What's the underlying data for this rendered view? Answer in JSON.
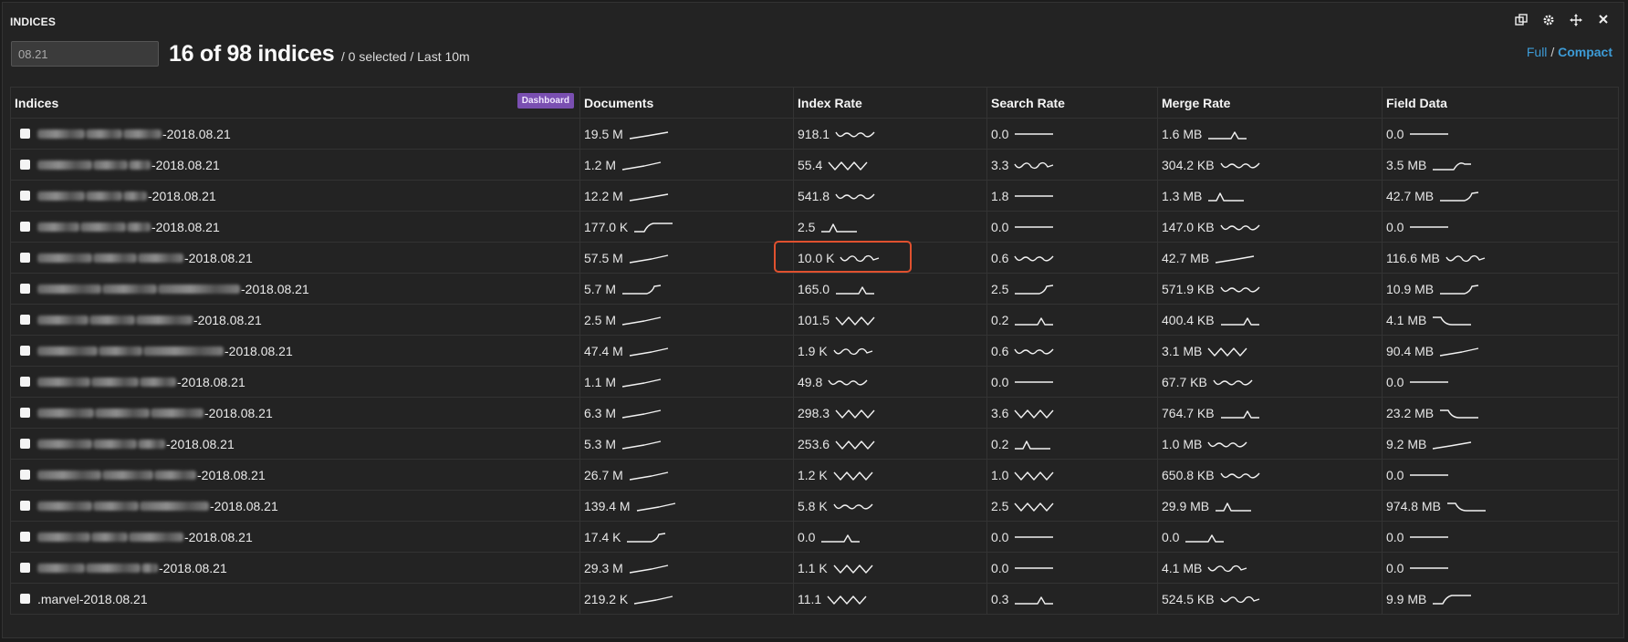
{
  "panel": {
    "title": "INDICES",
    "tools": [
      "copy-icon",
      "gear-icon",
      "move-icon",
      "close-icon"
    ]
  },
  "filter": {
    "value": "08.21"
  },
  "summary": {
    "count": "16 of 98 indices",
    "detail": "/ 0 selected / Last 10m"
  },
  "view": {
    "full": "Full",
    "separator": "/",
    "compact": "Compact"
  },
  "table": {
    "columns": [
      "Indices",
      "Documents",
      "Index Rate",
      "Search Rate",
      "Merge Rate",
      "Field Data"
    ],
    "dashboard_label": "Dashboard",
    "rows": [
      {
        "suffix": "-2018.08.21",
        "documents": "19.5 M",
        "index_rate": "918.1",
        "search_rate": "0.0",
        "merge_rate": "1.6 MB",
        "field_data": "0.0"
      },
      {
        "suffix": "-2018.08.21",
        "documents": "1.2 M",
        "index_rate": "55.4",
        "search_rate": "3.3",
        "merge_rate": "304.2 KB",
        "field_data": "3.5 MB"
      },
      {
        "suffix": "-2018.08.21",
        "documents": "12.2 M",
        "index_rate": "541.8",
        "search_rate": "1.8",
        "merge_rate": "1.3 MB",
        "field_data": "42.7 MB"
      },
      {
        "suffix": "-2018.08.21",
        "documents": "177.0 K",
        "index_rate": "2.5",
        "search_rate": "0.0",
        "merge_rate": "147.0 KB",
        "field_data": "0.0"
      },
      {
        "suffix": "-2018.08.21",
        "documents": "57.5 M",
        "index_rate": "10.0 K",
        "search_rate": "0.6",
        "merge_rate": "42.7 MB",
        "field_data": "116.6 MB"
      },
      {
        "suffix": "-2018.08.21",
        "documents": "5.7 M",
        "index_rate": "165.0",
        "search_rate": "2.5",
        "merge_rate": "571.9 KB",
        "field_data": "10.9 MB"
      },
      {
        "suffix": "-2018.08.21",
        "documents": "2.5 M",
        "index_rate": "101.5",
        "search_rate": "0.2",
        "merge_rate": "400.4 KB",
        "field_data": "4.1 MB"
      },
      {
        "suffix": "-2018.08.21",
        "documents": "47.4 M",
        "index_rate": "1.9 K",
        "search_rate": "0.6",
        "merge_rate": "3.1 MB",
        "field_data": "90.4 MB"
      },
      {
        "suffix": "-2018.08.21",
        "documents": "1.1 M",
        "index_rate": "49.8",
        "search_rate": "0.0",
        "merge_rate": "67.7 KB",
        "field_data": "0.0"
      },
      {
        "suffix": "-2018.08.21",
        "documents": "6.3 M",
        "index_rate": "298.3",
        "search_rate": "3.6",
        "merge_rate": "764.7 KB",
        "field_data": "23.2 MB"
      },
      {
        "suffix": "-2018.08.21",
        "documents": "5.3 M",
        "index_rate": "253.6",
        "search_rate": "0.2",
        "merge_rate": "1.0 MB",
        "field_data": "9.2 MB"
      },
      {
        "suffix": "-2018.08.21",
        "documents": "26.7 M",
        "index_rate": "1.2 K",
        "search_rate": "1.0",
        "merge_rate": "650.8 KB",
        "field_data": "0.0"
      },
      {
        "suffix": "-2018.08.21",
        "documents": "139.4 M",
        "index_rate": "5.8 K",
        "search_rate": "2.5",
        "merge_rate": "29.9 MB",
        "field_data": "974.8 MB"
      },
      {
        "suffix": "-2018.08.21",
        "documents": "17.4 K",
        "index_rate": "0.0",
        "search_rate": "0.0",
        "merge_rate": "0.0",
        "field_data": "0.0"
      },
      {
        "suffix": "-2018.08.21",
        "documents": "29.3 M",
        "index_rate": "1.1 K",
        "search_rate": "0.0",
        "merge_rate": "4.1 MB",
        "field_data": "0.0"
      },
      {
        "suffix": ".marvel-2018.08.21",
        "documents": "219.2 K",
        "index_rate": "11.1",
        "search_rate": "0.3",
        "merge_rate": "524.5 KB",
        "field_data": "9.9 MB"
      }
    ]
  }
}
